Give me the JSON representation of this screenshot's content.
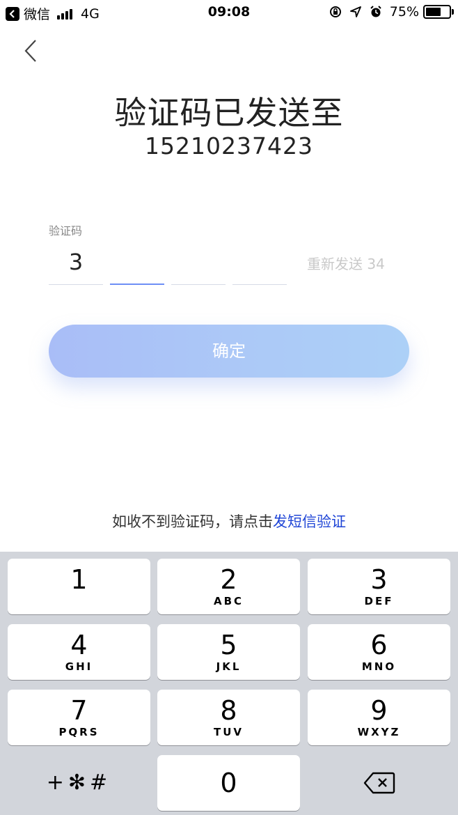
{
  "status_bar": {
    "app_name": "微信",
    "network": "4G",
    "time": "09:08",
    "battery_text": "75%",
    "battery_level": 0.75
  },
  "title": "验证码已发送至",
  "phone": "15210237423",
  "code": {
    "label": "验证码",
    "digits": [
      "3",
      "",
      "",
      ""
    ],
    "resend": "重新发送 34"
  },
  "confirm_label": "确定",
  "hint": {
    "text": "如收不到验证码，请点击",
    "link": "发短信验证"
  },
  "keyboard": {
    "keys": [
      {
        "num": "1",
        "letters": ""
      },
      {
        "num": "2",
        "letters": "ABC"
      },
      {
        "num": "3",
        "letters": "DEF"
      },
      {
        "num": "4",
        "letters": "GHI"
      },
      {
        "num": "5",
        "letters": "JKL"
      },
      {
        "num": "6",
        "letters": "MNO"
      },
      {
        "num": "7",
        "letters": "PQRS"
      },
      {
        "num": "8",
        "letters": "TUV"
      },
      {
        "num": "9",
        "letters": "WXYZ"
      }
    ],
    "symbols": "+✻#",
    "zero": "0"
  },
  "colors": {
    "accent": "#6e8ef5",
    "link": "#1f45d6",
    "button_start": "#a9bdf7",
    "button_end": "#acd0f7"
  }
}
